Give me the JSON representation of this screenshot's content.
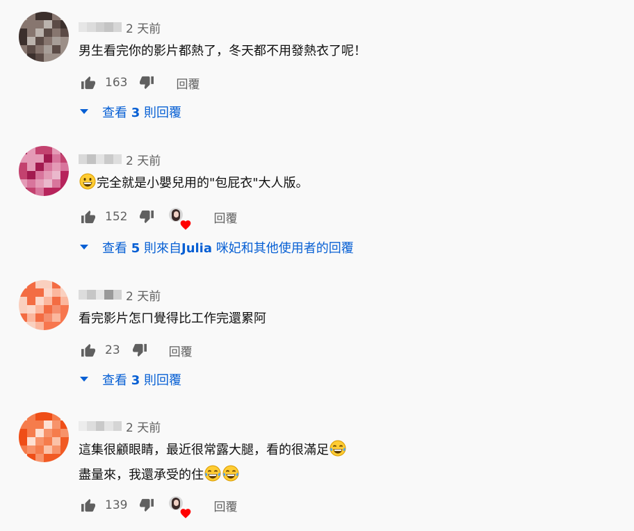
{
  "comments": [
    {
      "time": "2 天前",
      "lines": [
        "男生看完你的影片都熱了，冬天都不用發熱衣了呢！"
      ],
      "likes": "163",
      "reply_label": "回覆",
      "view_replies": {
        "prefix": "查看 ",
        "count": "3",
        "suffix": " 則回覆"
      },
      "avatar_colors": [
        "#9c8f88",
        "#5b4b46",
        "#a79e98",
        "#3c302d",
        "#87766f",
        "#bbb3ad"
      ]
    },
    {
      "time": "2 天前",
      "line_prefix": "完全就是小嬰兒用的\"包屁衣\"大人版。",
      "likes": "152",
      "reply_label": "回覆",
      "view_replies": {
        "prefix": "查看 ",
        "count": "5",
        "suffix": " 則來自",
        "author": "Julia",
        "tail": " 咪妃和其他使用者的回覆"
      },
      "avatar_colors": [
        "#b7245c",
        "#d8759c",
        "#eab8cc",
        "#c3426f",
        "#e49ab6",
        "#a21a4f"
      ]
    },
    {
      "time": "2 天前",
      "lines": [
        "看完影片怎ㄇ覺得比工作完還累阿"
      ],
      "likes": "23",
      "reply_label": "回覆",
      "view_replies": {
        "prefix": "查看 ",
        "count": "3",
        "suffix": " 則回覆"
      },
      "avatar_colors": [
        "#f7764e",
        "#fbb79e",
        "#f58e6e",
        "#fad0bf",
        "#f36c43",
        "#fcd7c9"
      ]
    },
    {
      "time": "2 天前",
      "line1": "這集很顧眼睛，最近很常露大腿，看的很滿足",
      "line2": "盡量來，我還承受的住",
      "likes": "139",
      "reply_label": "回覆",
      "avatar_colors": [
        "#f15a24",
        "#f7936a",
        "#fbc2a8",
        "#ef4e17",
        "#f57c4c",
        "#fde0d2"
      ]
    }
  ],
  "colors": {
    "link": "#065fd4",
    "meta": "#606060",
    "heart": "#ff0000"
  },
  "icons": {
    "like": "thumbs-up-icon",
    "dislike": "thumbs-down-icon",
    "expand": "caret-down-icon",
    "heart": "heart-icon",
    "emoji_grin": "grinning-face-icon",
    "emoji_tears": "tears-of-joy-icon"
  }
}
